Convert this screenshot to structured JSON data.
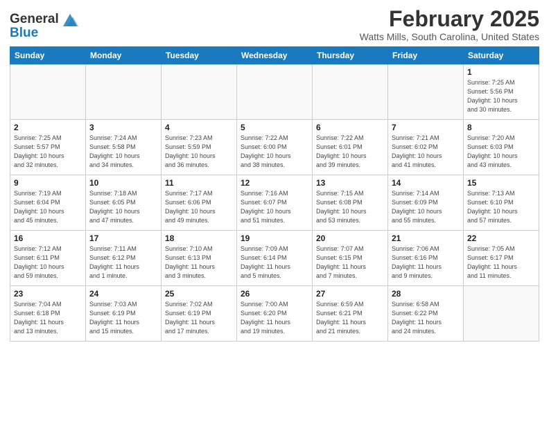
{
  "header": {
    "logo_line1": "General",
    "logo_line2": "Blue",
    "month": "February 2025",
    "location": "Watts Mills, South Carolina, United States"
  },
  "days_of_week": [
    "Sunday",
    "Monday",
    "Tuesday",
    "Wednesday",
    "Thursday",
    "Friday",
    "Saturday"
  ],
  "weeks": [
    [
      {
        "num": "",
        "info": ""
      },
      {
        "num": "",
        "info": ""
      },
      {
        "num": "",
        "info": ""
      },
      {
        "num": "",
        "info": ""
      },
      {
        "num": "",
        "info": ""
      },
      {
        "num": "",
        "info": ""
      },
      {
        "num": "1",
        "info": "Sunrise: 7:25 AM\nSunset: 5:56 PM\nDaylight: 10 hours\nand 30 minutes."
      }
    ],
    [
      {
        "num": "2",
        "info": "Sunrise: 7:25 AM\nSunset: 5:57 PM\nDaylight: 10 hours\nand 32 minutes."
      },
      {
        "num": "3",
        "info": "Sunrise: 7:24 AM\nSunset: 5:58 PM\nDaylight: 10 hours\nand 34 minutes."
      },
      {
        "num": "4",
        "info": "Sunrise: 7:23 AM\nSunset: 5:59 PM\nDaylight: 10 hours\nand 36 minutes."
      },
      {
        "num": "5",
        "info": "Sunrise: 7:22 AM\nSunset: 6:00 PM\nDaylight: 10 hours\nand 38 minutes."
      },
      {
        "num": "6",
        "info": "Sunrise: 7:22 AM\nSunset: 6:01 PM\nDaylight: 10 hours\nand 39 minutes."
      },
      {
        "num": "7",
        "info": "Sunrise: 7:21 AM\nSunset: 6:02 PM\nDaylight: 10 hours\nand 41 minutes."
      },
      {
        "num": "8",
        "info": "Sunrise: 7:20 AM\nSunset: 6:03 PM\nDaylight: 10 hours\nand 43 minutes."
      }
    ],
    [
      {
        "num": "9",
        "info": "Sunrise: 7:19 AM\nSunset: 6:04 PM\nDaylight: 10 hours\nand 45 minutes."
      },
      {
        "num": "10",
        "info": "Sunrise: 7:18 AM\nSunset: 6:05 PM\nDaylight: 10 hours\nand 47 minutes."
      },
      {
        "num": "11",
        "info": "Sunrise: 7:17 AM\nSunset: 6:06 PM\nDaylight: 10 hours\nand 49 minutes."
      },
      {
        "num": "12",
        "info": "Sunrise: 7:16 AM\nSunset: 6:07 PM\nDaylight: 10 hours\nand 51 minutes."
      },
      {
        "num": "13",
        "info": "Sunrise: 7:15 AM\nSunset: 6:08 PM\nDaylight: 10 hours\nand 53 minutes."
      },
      {
        "num": "14",
        "info": "Sunrise: 7:14 AM\nSunset: 6:09 PM\nDaylight: 10 hours\nand 55 minutes."
      },
      {
        "num": "15",
        "info": "Sunrise: 7:13 AM\nSunset: 6:10 PM\nDaylight: 10 hours\nand 57 minutes."
      }
    ],
    [
      {
        "num": "16",
        "info": "Sunrise: 7:12 AM\nSunset: 6:11 PM\nDaylight: 10 hours\nand 59 minutes."
      },
      {
        "num": "17",
        "info": "Sunrise: 7:11 AM\nSunset: 6:12 PM\nDaylight: 11 hours\nand 1 minute."
      },
      {
        "num": "18",
        "info": "Sunrise: 7:10 AM\nSunset: 6:13 PM\nDaylight: 11 hours\nand 3 minutes."
      },
      {
        "num": "19",
        "info": "Sunrise: 7:09 AM\nSunset: 6:14 PM\nDaylight: 11 hours\nand 5 minutes."
      },
      {
        "num": "20",
        "info": "Sunrise: 7:07 AM\nSunset: 6:15 PM\nDaylight: 11 hours\nand 7 minutes."
      },
      {
        "num": "21",
        "info": "Sunrise: 7:06 AM\nSunset: 6:16 PM\nDaylight: 11 hours\nand 9 minutes."
      },
      {
        "num": "22",
        "info": "Sunrise: 7:05 AM\nSunset: 6:17 PM\nDaylight: 11 hours\nand 11 minutes."
      }
    ],
    [
      {
        "num": "23",
        "info": "Sunrise: 7:04 AM\nSunset: 6:18 PM\nDaylight: 11 hours\nand 13 minutes."
      },
      {
        "num": "24",
        "info": "Sunrise: 7:03 AM\nSunset: 6:19 PM\nDaylight: 11 hours\nand 15 minutes."
      },
      {
        "num": "25",
        "info": "Sunrise: 7:02 AM\nSunset: 6:19 PM\nDaylight: 11 hours\nand 17 minutes."
      },
      {
        "num": "26",
        "info": "Sunrise: 7:00 AM\nSunset: 6:20 PM\nDaylight: 11 hours\nand 19 minutes."
      },
      {
        "num": "27",
        "info": "Sunrise: 6:59 AM\nSunset: 6:21 PM\nDaylight: 11 hours\nand 21 minutes."
      },
      {
        "num": "28",
        "info": "Sunrise: 6:58 AM\nSunset: 6:22 PM\nDaylight: 11 hours\nand 24 minutes."
      },
      {
        "num": "",
        "info": ""
      }
    ]
  ]
}
